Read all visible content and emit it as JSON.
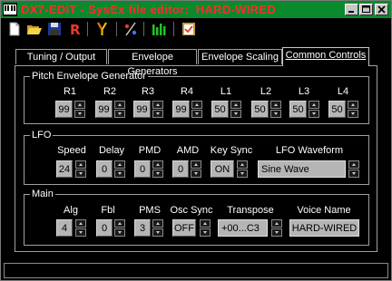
{
  "window": {
    "title": "DX7-EDIT - SysEx file editor:  HARD-WIRED"
  },
  "tabs": [
    "Tuning / Output",
    "Envelope Generators",
    "Envelope Scaling",
    "Common Controls"
  ],
  "pitch_eg": {
    "legend": "Pitch Envelope Generator",
    "params": [
      {
        "label": "R1",
        "value": "99"
      },
      {
        "label": "R2",
        "value": "99"
      },
      {
        "label": "R3",
        "value": "99"
      },
      {
        "label": "R4",
        "value": "99"
      },
      {
        "label": "L1",
        "value": "50"
      },
      {
        "label": "L2",
        "value": "50"
      },
      {
        "label": "L3",
        "value": "50"
      },
      {
        "label": "L4",
        "value": "50"
      }
    ]
  },
  "lfo": {
    "legend": "LFO",
    "speed": {
      "label": "Speed",
      "value": "24"
    },
    "delay": {
      "label": "Delay",
      "value": "0"
    },
    "pmd": {
      "label": "PMD",
      "value": "0"
    },
    "amd": {
      "label": "AMD",
      "value": "0"
    },
    "key_sync": {
      "label": "Key Sync",
      "value": "ON"
    },
    "waveform": {
      "label": "LFO Waveform",
      "value": "Sine Wave"
    }
  },
  "main": {
    "legend": "Main",
    "alg": {
      "label": "Alg",
      "value": "4"
    },
    "fbl": {
      "label": "Fbl",
      "value": "0"
    },
    "pms": {
      "label": "PMS",
      "value": "3"
    },
    "osc_sync": {
      "label": "Osc Sync",
      "value": "OFF"
    },
    "transpose": {
      "label": "Transpose",
      "value": "+00...C3"
    },
    "voice_name": {
      "label": "Voice Name",
      "value": "HARD-WIRED"
    }
  },
  "status": {
    "text": ""
  },
  "colors": {
    "titlebar": "#0a8a2c",
    "title_text": "#ff2a2a",
    "field": "#b5b5b5",
    "accent_green": "#21c421",
    "accent_yellow": "#f0d000"
  },
  "toolbar_icons": [
    "new-file-icon",
    "open-folder-icon",
    "save-disk-icon",
    "r-icon",
    "tuning-fork-icon",
    "division-icon",
    "bars-icon",
    "clipboard-icon"
  ]
}
